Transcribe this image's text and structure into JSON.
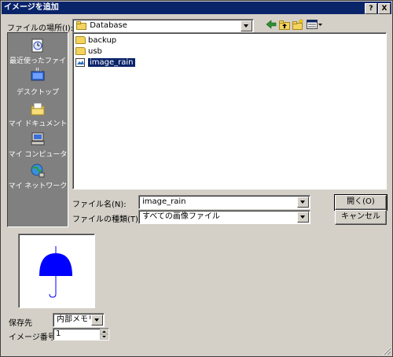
{
  "title": "イメージを追加",
  "titlebar": {
    "help": "?",
    "close": "X"
  },
  "location": {
    "label": "ファイルの場所(I):",
    "value": "Database"
  },
  "places": [
    {
      "label": "最近使ったファイル",
      "icon": "recent-icon"
    },
    {
      "label": "デスクトップ",
      "icon": "desktop-icon"
    },
    {
      "label": "マイ ドキュメント",
      "icon": "my-documents-icon"
    },
    {
      "label": "マイ コンピュータ",
      "icon": "my-computer-icon"
    },
    {
      "label": "マイ ネットワーク",
      "icon": "my-network-icon"
    }
  ],
  "files": [
    {
      "name": "backup",
      "type": "folder"
    },
    {
      "name": "usb",
      "type": "folder"
    },
    {
      "name": "image_rain",
      "type": "image",
      "selected": true
    }
  ],
  "filename": {
    "label": "ファイル名(N):",
    "value": "image_rain"
  },
  "filetype": {
    "label": "ファイルの種類(T):",
    "value": "すべての画像ファイル"
  },
  "buttons": {
    "open": "開く(O)",
    "cancel": "キャンセル"
  },
  "save_to": {
    "label": "保存先",
    "value": "内部メモリ"
  },
  "image_number": {
    "label": "イメージ番号",
    "value": "1"
  },
  "colors": {
    "titlebar": "#0a246a",
    "umbrella": "#0000ff",
    "face": "#d4d0c8",
    "places_bg": "#808080"
  }
}
